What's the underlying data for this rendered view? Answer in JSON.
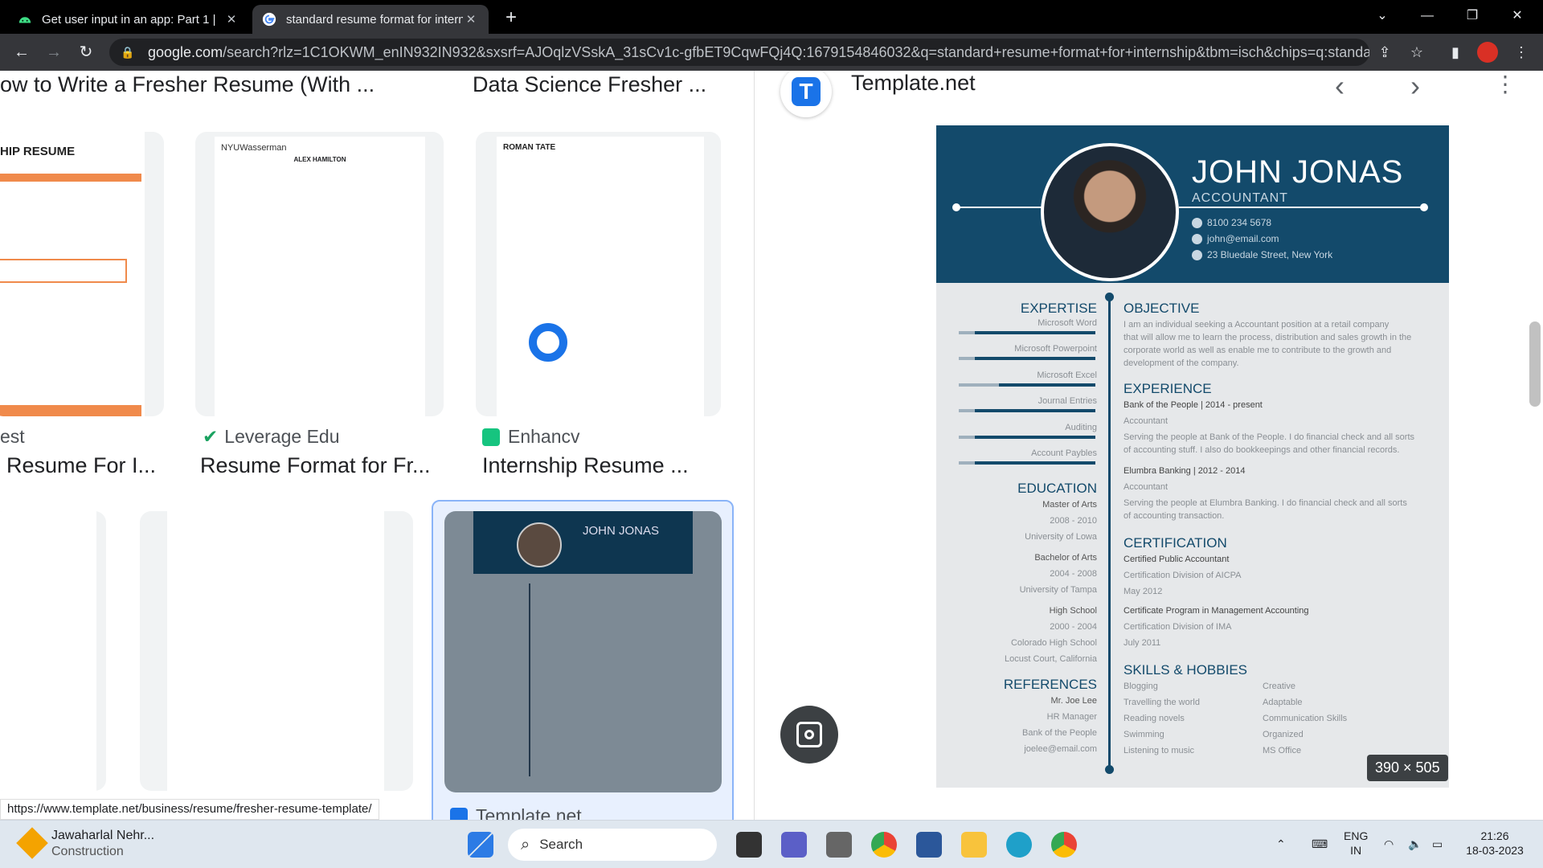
{
  "browser": {
    "tabs": [
      {
        "title": "Get user input in an app: Part 1 |",
        "icon": "android-icon",
        "color": "#3ddc84"
      },
      {
        "title": "standard resume format for intern",
        "icon": "google-icon"
      }
    ],
    "url_host": "google.com",
    "url_rest": "/search?rlz=1C1OKWM_enIN932IN932&sxsrf=AJOqlzVSskA_31sCv1c-gfbET9CqwFQj4Q:1679154846032&q=standard+resume+format+for+internship&tbm=isch&chips=q:standard+r..."
  },
  "results": {
    "row1_captions": [
      "ow to Write a Fresher Resume (With ...",
      "Data Science Fresher ..."
    ],
    "row2": [
      {
        "source": "est",
        "caption": "Resume For I..."
      },
      {
        "source": "Leverage Edu",
        "caption": "Resume Format for Fr..."
      },
      {
        "source": "Enhancv",
        "caption": "Internship Resume ..."
      }
    ],
    "row3_source": "Template.net",
    "thumb1_heading": "HIP RESUME",
    "thumb2_heading": "NYUWasserman",
    "thumb2_name": "ALEX HAMILTON",
    "thumb3_name": "ROMAN TATE",
    "thumb6_name": "JOHN JONAS"
  },
  "status_url": "https://www.template.net/business/resume/fresher-resume-template/",
  "preview": {
    "source": "Template.net",
    "dimensions": "390 × 505",
    "resume": {
      "name": "JOHN JONAS",
      "role": "ACCOUNTANT",
      "phone": "8100 234 5678",
      "email": "john@email.com",
      "address": "23 Bluedale Street, New York",
      "expertise_title": "EXPERTISE",
      "expertise": [
        "Microsoft Word",
        "Microsoft Powerpoint",
        "Microsoft Excel",
        "Journal Entries",
        "Auditing",
        "Account Paybles"
      ],
      "education_title": "EDUCATION",
      "education": [
        {
          "degree": "Master of Arts",
          "years": "2008 - 2010",
          "school": "University of Lowa"
        },
        {
          "degree": "Bachelor of Arts",
          "years": "2004 - 2008",
          "school": "University of Tampa"
        },
        {
          "degree": "High School",
          "years": "2000 - 2004",
          "school": "Colorado High School",
          "extra": "Locust Court, California"
        }
      ],
      "references_title": "REFERENCES",
      "reference": [
        "Mr. Joe Lee",
        "HR Manager",
        "Bank of the People",
        "joelee@email.com"
      ],
      "objective_title": "OBJECTIVE",
      "objective": [
        "I am an individual seeking a Accountant position at a retail company",
        "that will allow me to learn the process, distribution and sales growth in the",
        "corporate world as well as enable me to contribute to the growth and",
        "development of the company."
      ],
      "experience_title": "EXPERIENCE",
      "experience": [
        {
          "heading": "Bank of the People | 2014 - present",
          "role": "Accountant",
          "lines": [
            "Serving the people at Bank of the People. I do financial check and all sorts",
            "of accounting stuff. I also do bookkeepings and other financial records."
          ]
        },
        {
          "heading": "Elumbra Banking | 2012 - 2014",
          "role": "Accountant",
          "lines": [
            "Serving the people at Elumbra Banking. I do financial check and all sorts",
            "of accounting transaction."
          ]
        }
      ],
      "certification_title": "CERTIFICATION",
      "certifications": [
        {
          "name": "Certified Public Accountant",
          "org": "Certification Division of AICPA",
          "date": "May 2012"
        },
        {
          "name": "Certificate Program in Management Accounting",
          "org": "Certification Division of IMA",
          "date": "July 2011"
        }
      ],
      "skills_title": "SKILLS & HOBBIES",
      "skills_left": [
        "Blogging",
        "Travelling the world",
        "Reading novels",
        "Swimming",
        "Listening to music"
      ],
      "skills_right": [
        "Creative",
        "Adaptable",
        "Communication Skills",
        "Organized",
        "MS Office"
      ]
    }
  },
  "taskbar": {
    "app_title": "Jawaharlal Nehr...",
    "app_subtitle": "Construction",
    "search": "Search",
    "lang1": "ENG",
    "lang2": "IN",
    "time": "21:26",
    "date": "18-03-2023"
  }
}
